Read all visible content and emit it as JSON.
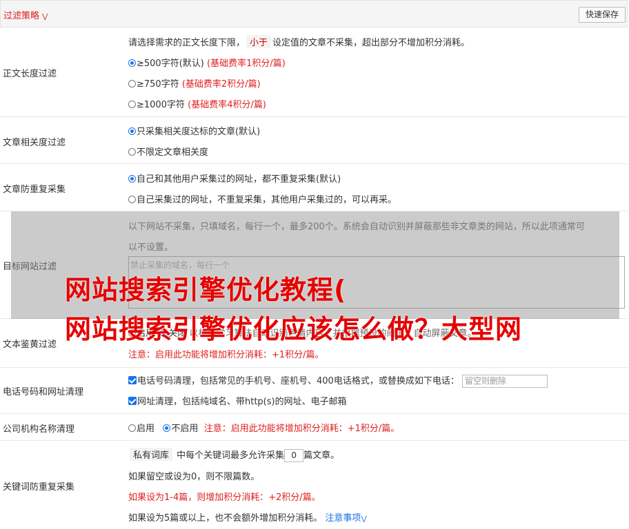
{
  "header": {
    "title": "过滤策略",
    "chevron": "chevron-down-icon",
    "quick_save": "快速保存"
  },
  "length_filter": {
    "label": "正文长度过滤",
    "desc_before": "请选择需求的正文长度下限，",
    "desc_tag": "小于",
    "desc_after": "设定值的文章不采集，超出部分不增加积分消耗。",
    "options": [
      {
        "text": "≥500字符(默认)",
        "note": "(基础费率1积分/篇)",
        "selected": true
      },
      {
        "text": "≥750字符",
        "note": "(基础费率2积分/篇)",
        "selected": false
      },
      {
        "text": "≥1000字符",
        "note": "(基础费率4积分/篇)",
        "selected": false
      }
    ]
  },
  "relevance_filter": {
    "label": "文章相关度过滤",
    "options": [
      {
        "text": "只采集相关度达标的文章(默认)",
        "selected": true
      },
      {
        "text": "不限定文章相关度",
        "selected": false
      }
    ]
  },
  "dedupe": {
    "label": "文章防重复采集",
    "options": [
      {
        "text": "自己和其他用户采集过的网址，都不重复采集(默认)",
        "selected": true
      },
      {
        "text": "自己采集过的网址，不重复采集，其他用户采集过的，可以再采。",
        "selected": false
      }
    ]
  },
  "site_filter": {
    "label": "目标网站过滤",
    "desc_line1": "以下网站不采集，只填域名，每行一个，最多200个。系统会自动识别并屏蔽那些非文章类的网站，所以此项通常可",
    "desc_line2": "以不设置。",
    "placeholder": "禁止采集的域名，每行一个"
  },
  "porn_filter": {
    "label": "文本鉴黄过滤",
    "option_on": "启用",
    "option_off": "关闭",
    "desc": "以机器学习算法自动识别色情内容，并根据预设的阈值，自动屏蔽文章。",
    "note": "注意：启用此功能将增加积分消耗：+1积分/篇。"
  },
  "phone_url": {
    "label": "电话号码和网址清理",
    "phone_text": "电话号码清理，包括常见的手机号、座机号、400电话格式，或替换成如下电话：",
    "phone_placeholder": "留空则删除",
    "url_text": "网址清理，包括纯域名、带http(s)的网址、电子邮箱"
  },
  "org_name": {
    "label": "公司机构名称清理",
    "option_on": "启用",
    "option_off": "不启用",
    "note": "注意：启用此功能将增加积分消耗：+1积分/篇。"
  },
  "keyword_dedupe": {
    "label": "关键词防重复采集",
    "tag": "私有词库",
    "text_before": "中每个关键词最多允许采集",
    "value": "0",
    "text_after": "篇文章。",
    "line2": "如果留空或设为0，则不限篇数。",
    "line3": "如果设为1-4篇，则增加积分消耗：+2积分/篇。",
    "line4": "如果设为5篇或以上，也不会额外增加积分消耗。",
    "notice_link": "注意事项"
  },
  "watermark": {
    "line1": "网站搜索引擎优化教程(",
    "line2": "网站搜索引擎优化应该怎么做？大型网"
  },
  "colors": {
    "accent": "#1a73e8",
    "warning": "#e02020"
  }
}
